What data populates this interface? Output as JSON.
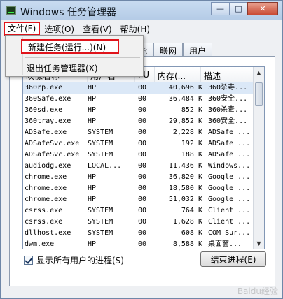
{
  "window": {
    "title": "Windows 任务管理器"
  },
  "titlebar_buttons": {
    "minimize": "—",
    "maximize": "□",
    "close": "✕"
  },
  "menubar": {
    "items": [
      {
        "label": "文件(F)"
      },
      {
        "label": "选项(O)"
      },
      {
        "label": "查看(V)"
      },
      {
        "label": "帮助(H)"
      }
    ]
  },
  "file_menu": {
    "items": [
      {
        "label": "新建任务(运行...)(N)"
      },
      {
        "label": "退出任务管理器(X)"
      }
    ]
  },
  "tabs": [
    {
      "label": "能"
    },
    {
      "label": "联网"
    },
    {
      "label": "用户"
    }
  ],
  "table": {
    "headers": [
      "映像名称",
      "用户名",
      "PU",
      "内存(...",
      "描述"
    ],
    "rows": [
      [
        "360rp.exe",
        "HP",
        "00",
        "40,696 K",
        "360杀毒..."
      ],
      [
        "360Safe.exe",
        "HP",
        "00",
        "36,484 K",
        "360安全..."
      ],
      [
        "360sd.exe",
        "HP",
        "00",
        "852 K",
        "360杀毒..."
      ],
      [
        "360tray.exe",
        "HP",
        "00",
        "29,852 K",
        "360安全..."
      ],
      [
        "ADSafe.exe",
        "SYSTEM",
        "00",
        "2,228 K",
        "ADSafe ..."
      ],
      [
        "ADSafeSvc.exe",
        "SYSTEM",
        "00",
        "192 K",
        "ADSafe ..."
      ],
      [
        "ADSafeSvc.exe",
        "SYSTEM",
        "00",
        "188 K",
        "ADSafe ..."
      ],
      [
        "audiodg.exe",
        "LOCAL...",
        "00",
        "11,436 K",
        "Windows..."
      ],
      [
        "chrome.exe",
        "HP",
        "00",
        "36,820 K",
        "Google ..."
      ],
      [
        "chrome.exe",
        "HP",
        "00",
        "18,580 K",
        "Google ..."
      ],
      [
        "chrome.exe",
        "HP",
        "00",
        "51,032 K",
        "Google ..."
      ],
      [
        "csrss.exe",
        "SYSTEM",
        "00",
        "764 K",
        "Client ..."
      ],
      [
        "csrss.exe",
        "SYSTEM",
        "00",
        "1,628 K",
        "Client ..."
      ],
      [
        "dllhost.exe",
        "SYSTEM",
        "00",
        "608 K",
        "COM Sur..."
      ],
      [
        "dwm.exe",
        "HP",
        "00",
        "8,588 K",
        "桌面窗..."
      ]
    ]
  },
  "show_all_processes": {
    "label": "显示所有用户的进程(S)"
  },
  "end_process_button": {
    "label": "结束进程(E)"
  },
  "watermark": {
    "text": "Baidu经验"
  }
}
